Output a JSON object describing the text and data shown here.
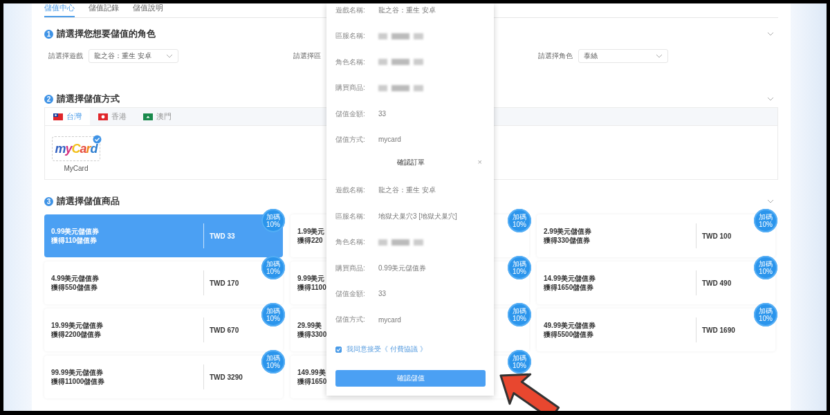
{
  "tabs": [
    {
      "label": "儲值中心",
      "selected": true
    },
    {
      "label": "儲值記錄",
      "selected": false
    },
    {
      "label": "儲值說明",
      "selected": false
    }
  ],
  "role_section": {
    "number": "1",
    "title": "請選擇您想要儲值的角色",
    "fields": [
      {
        "label": "請選擇遊戲",
        "value": "龍之谷：重生 安卓"
      },
      {
        "label": "請選擇區"
      },
      {
        "label": "請選擇角色",
        "value": "泰絲"
      }
    ]
  },
  "payment_section": {
    "number": "2",
    "title": "請選擇儲值方式",
    "regions": [
      {
        "label": "台灣",
        "kind": "tw",
        "selected": true
      },
      {
        "label": "香港",
        "kind": "hk",
        "selected": false
      },
      {
        "label": "澳門",
        "kind": "mo",
        "selected": false
      }
    ],
    "methods": [
      {
        "logo_text": "myCard",
        "label": "MyCard",
        "selected": true
      }
    ]
  },
  "product_section": {
    "number": "3",
    "title": "請選擇儲值商品",
    "products": [
      {
        "name": "0.99美元儲值券",
        "bonus": "獲得110儲值券",
        "price": "TWD 33",
        "badge": [
          "加碼",
          "10%"
        ],
        "selected": true
      },
      {
        "name": "1.99美元",
        "bonus": "獲得220",
        "badge": [
          "加碼",
          "10%"
        ],
        "selected": false
      },
      {
        "name": "2.99美元儲值券",
        "bonus": "獲得330儲值券",
        "price": "TWD 100",
        "badge": [
          "加碼",
          "10%"
        ],
        "selected": false
      },
      {
        "name": "4.99美元儲值券",
        "bonus": "獲得550儲值券",
        "price": "TWD 170",
        "badge": [
          "加碼",
          "10%"
        ],
        "selected": false
      },
      {
        "name": "9.99美元",
        "bonus": "獲得1100",
        "badge": [
          "加碼",
          "10%"
        ],
        "selected": false
      },
      {
        "name": "14.99美元儲值券",
        "bonus": "獲得1650儲值券",
        "price": "TWD 490",
        "badge": [
          "加碼",
          "10%"
        ],
        "selected": false
      },
      {
        "name": "19.99美元儲值券",
        "bonus": "獲得2200儲值券",
        "price": "TWD 670",
        "badge": [
          "加碼",
          "10%"
        ],
        "selected": false
      },
      {
        "name": "29.99美",
        "bonus": "獲得3300",
        "badge": [
          "加碼",
          "10%"
        ],
        "selected": false
      },
      {
        "name": "49.99美元儲值券",
        "bonus": "獲得5500儲值券",
        "price": "TWD 1690",
        "badge": [
          "加碼",
          "10%"
        ],
        "selected": false
      },
      {
        "name": "99.99美元儲值券",
        "bonus": "獲得11000儲值券",
        "price": "TWD 3290",
        "badge": [
          "加碼",
          "10%"
        ],
        "selected": false
      },
      {
        "name": "149.99美",
        "bonus": "獲得1650",
        "badge": [
          "加碼",
          "10%"
        ],
        "selected": false
      }
    ]
  },
  "order_modal": {
    "summary_rows": [
      {
        "label": "遊戲名稱:",
        "kind": "text",
        "value": "龍之谷：重生 安卓"
      },
      {
        "label": "區服名稱:",
        "kind": "blurred"
      },
      {
        "label": "角色名稱:",
        "kind": "blurred"
      },
      {
        "label": "購買商品:",
        "kind": "blurred"
      },
      {
        "label": "儲值金額:",
        "kind": "text",
        "value": "33"
      },
      {
        "label": "儲值方式:",
        "kind": "text",
        "value": "mycard"
      }
    ],
    "title": "確認訂單",
    "close": "×",
    "rows": [
      {
        "label": "遊戲名稱:",
        "kind": "text",
        "value": "龍之谷：重生 安卓"
      },
      {
        "label": "區服名稱:",
        "kind": "text",
        "value": "地獄犬巢穴3 [地獄犬巢穴]"
      },
      {
        "label": "角色名稱:",
        "kind": "blurred"
      },
      {
        "label": "購買商品:",
        "kind": "text",
        "value": "0.99美元儲值券"
      },
      {
        "label": "儲值金額:",
        "kind": "text",
        "value": "33"
      },
      {
        "label": "儲值方式:",
        "kind": "text",
        "value": "mycard"
      }
    ],
    "agreement": {
      "text": "我同意接受《 付費協議 》",
      "checked": true
    },
    "confirm_button": "確認儲值"
  }
}
